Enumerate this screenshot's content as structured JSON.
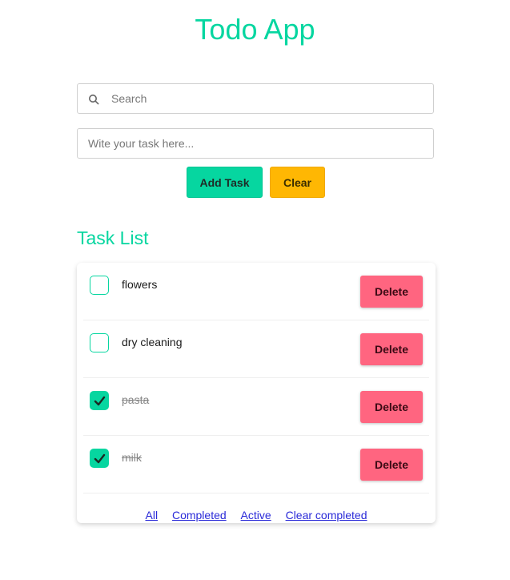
{
  "app": {
    "title": "Todo App"
  },
  "search": {
    "placeholder": "Search",
    "value": ""
  },
  "task_input": {
    "placeholder": "Wite your task here...",
    "value": ""
  },
  "buttons": {
    "add_label": "Add Task",
    "clear_label": "Clear"
  },
  "list": {
    "title": "Task List",
    "tasks": [
      {
        "label": "flowers",
        "completed": false,
        "delete_label": "Delete"
      },
      {
        "label": "dry cleaning",
        "completed": false,
        "delete_label": "Delete"
      },
      {
        "label": "pasta",
        "completed": true,
        "delete_label": "Delete"
      },
      {
        "label": "milk",
        "completed": true,
        "delete_label": "Delete"
      }
    ],
    "filters": [
      "All",
      "Completed",
      "Active",
      "Clear completed"
    ]
  },
  "colors": {
    "accent": "#06d6a0",
    "clear": "#ffb703",
    "delete": "#ff6580",
    "link": "#2a2ad8"
  },
  "icons": {
    "search": "search-icon",
    "check": "check-icon"
  }
}
